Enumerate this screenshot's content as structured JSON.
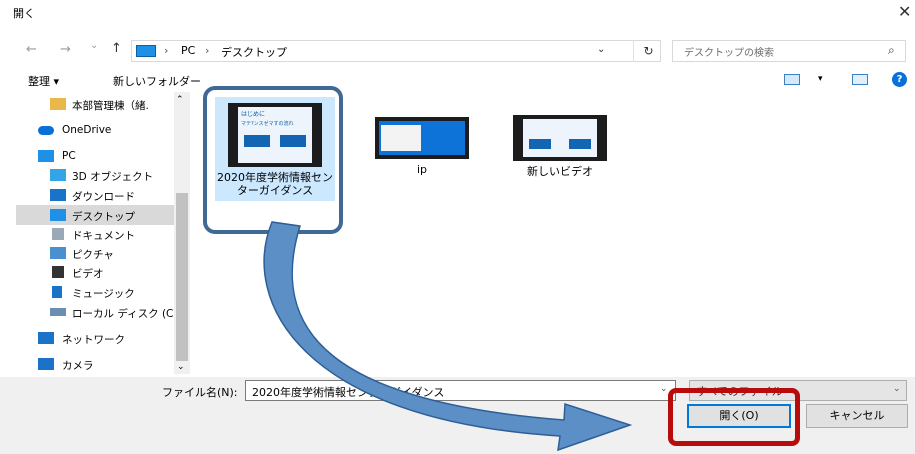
{
  "window": {
    "title": "開く",
    "close_glyph": "✕"
  },
  "nav": {
    "back": "←",
    "forward": "→",
    "recent": "⌄",
    "up": "↑"
  },
  "address": {
    "crumbs": [
      "PC",
      "デスクトップ"
    ],
    "separator": "›",
    "dropdown": "⌄",
    "refresh": "↻"
  },
  "search": {
    "placeholder": "デスクトップの検索",
    "icon": "⌕"
  },
  "toolbar": {
    "organize": "整理 ▾",
    "new_folder": "新しいフォルダー",
    "view_dd": "▾",
    "help": "?"
  },
  "sidebar": {
    "items": [
      {
        "label": "本部管理棟（緒.",
        "icon": "folder-icon",
        "color": "#e8b84a"
      },
      {
        "label": "OneDrive",
        "icon": "cloud-icon",
        "color": "#0a6fd6"
      },
      {
        "label": "PC",
        "icon": "pc-icon",
        "color": "#1e90e6"
      },
      {
        "label": "3D オブジェクト",
        "icon": "cube-icon",
        "color": "#34a4e8"
      },
      {
        "label": "ダウンロード",
        "icon": "download-icon",
        "color": "#1a73c8"
      },
      {
        "label": "デスクトップ",
        "icon": "desktop-icon",
        "color": "#1e90e6"
      },
      {
        "label": "ドキュメント",
        "icon": "document-icon",
        "color": "#9aa8b8"
      },
      {
        "label": "ピクチャ",
        "icon": "pictures-icon",
        "color": "#4a8fd0"
      },
      {
        "label": "ビデオ",
        "icon": "video-icon",
        "color": "#333333"
      },
      {
        "label": "ミュージック",
        "icon": "music-icon",
        "color": "#1a73c8"
      },
      {
        "label": "ローカル ディスク (C",
        "icon": "disk-icon",
        "color": "#6a8fb0"
      },
      {
        "label": "ネットワーク",
        "icon": "network-icon",
        "color": "#1a73c8"
      },
      {
        "label": "カメラ",
        "icon": "camera-icon",
        "color": "#1a73c8"
      }
    ],
    "scroll_up": "⌃",
    "scroll_down": "⌄"
  },
  "files": [
    {
      "name": "2020年度学術情報センターガイダンス",
      "thumb_lines": [
        "はじめに",
        "マテ?ンスゼマすの流れ"
      ]
    },
    {
      "name": "ip"
    },
    {
      "name": "新しいビデオ"
    }
  ],
  "bottom": {
    "filename_label": "ファイル名(N):",
    "filename_value": "2020年度学術情報センターガイダンス",
    "filename_dd": "⌄",
    "filter_value": "すべてのファイル",
    "filter_dd": "⌄",
    "open_button": "開く(O)",
    "cancel_button": "キャンセル"
  },
  "colors": {
    "annotation_box_blue": "#3f6a93",
    "annotation_box_red": "#b80b0b",
    "annotation_arrow": "#5b8fc6",
    "selection": "#cce8ff",
    "accent": "#0078d7"
  }
}
